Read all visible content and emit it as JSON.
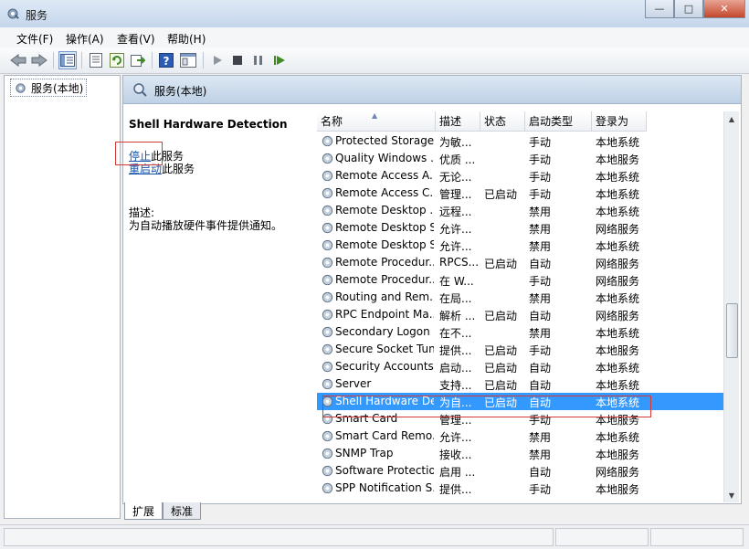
{
  "window": {
    "title": "服务",
    "min_glyph": "—",
    "max_glyph": "□",
    "close_glyph": "✕"
  },
  "menu": [
    {
      "label": "文件(F)"
    },
    {
      "label": "操作(A)"
    },
    {
      "label": "查看(V)"
    },
    {
      "label": "帮助(H)"
    }
  ],
  "toolbar": {
    "icons": [
      "back-arrow-icon",
      "forward-arrow-icon",
      "show-tree-icon",
      "properties-icon",
      "refresh-icon",
      "export-icon",
      "help-icon",
      "console-view-icon",
      "start-icon",
      "stop-icon",
      "pause-icon",
      "restart-icon"
    ]
  },
  "tree": {
    "root_label": "服务(本地)"
  },
  "banner": {
    "label": "服务(本地)"
  },
  "detail": {
    "service_name": "Shell Hardware Detection",
    "stop_link": "停止",
    "stop_suffix": "此服务",
    "restart_link": "重启动",
    "restart_suffix": "此服务",
    "desc_label": "描述:",
    "desc_text": "为自动播放硬件事件提供通知。"
  },
  "columns": [
    {
      "label": "名称"
    },
    {
      "label": "描述"
    },
    {
      "label": "状态"
    },
    {
      "label": "启动类型"
    },
    {
      "label": "登录为"
    }
  ],
  "rows": [
    {
      "name": "Protected Storage",
      "desc": "为敏...",
      "status": "",
      "startup": "手动",
      "logon": "本地系统",
      "selected": false
    },
    {
      "name": "Quality Windows ...",
      "desc": "优质 ...",
      "status": "",
      "startup": "手动",
      "logon": "本地服务",
      "selected": false
    },
    {
      "name": "Remote Access A...",
      "desc": "无论...",
      "status": "",
      "startup": "手动",
      "logon": "本地系统",
      "selected": false
    },
    {
      "name": "Remote Access C...",
      "desc": "管理...",
      "status": "已启动",
      "startup": "手动",
      "logon": "本地系统",
      "selected": false
    },
    {
      "name": "Remote Desktop ...",
      "desc": "远程...",
      "status": "",
      "startup": "禁用",
      "logon": "本地系统",
      "selected": false
    },
    {
      "name": "Remote Desktop S...",
      "desc": "允许...",
      "status": "",
      "startup": "禁用",
      "logon": "网络服务",
      "selected": false
    },
    {
      "name": "Remote Desktop S...",
      "desc": "允许...",
      "status": "",
      "startup": "禁用",
      "logon": "本地系统",
      "selected": false
    },
    {
      "name": "Remote Procedur...",
      "desc": "RPCS...",
      "status": "已启动",
      "startup": "自动",
      "logon": "网络服务",
      "selected": false
    },
    {
      "name": "Remote Procedur...",
      "desc": "在 W...",
      "status": "",
      "startup": "手动",
      "logon": "网络服务",
      "selected": false
    },
    {
      "name": "Routing and Rem...",
      "desc": "在局...",
      "status": "",
      "startup": "禁用",
      "logon": "本地系统",
      "selected": false
    },
    {
      "name": "RPC Endpoint Ma...",
      "desc": "解析 ...",
      "status": "已启动",
      "startup": "自动",
      "logon": "网络服务",
      "selected": false
    },
    {
      "name": "Secondary Logon",
      "desc": "在不...",
      "status": "",
      "startup": "禁用",
      "logon": "本地系统",
      "selected": false
    },
    {
      "name": "Secure Socket Tun...",
      "desc": "提供...",
      "status": "已启动",
      "startup": "手动",
      "logon": "本地服务",
      "selected": false
    },
    {
      "name": "Security Accounts...",
      "desc": "启动...",
      "status": "已启动",
      "startup": "自动",
      "logon": "本地系统",
      "selected": false
    },
    {
      "name": "Server",
      "desc": "支持...",
      "status": "已启动",
      "startup": "自动",
      "logon": "本地系统",
      "selected": false
    },
    {
      "name": "Shell Hardware De...",
      "desc": "为自...",
      "status": "已启动",
      "startup": "自动",
      "logon": "本地系统",
      "selected": true
    },
    {
      "name": "Smart Card",
      "desc": "管理...",
      "status": "",
      "startup": "手动",
      "logon": "本地服务",
      "selected": false
    },
    {
      "name": "Smart Card Remo...",
      "desc": "允许...",
      "status": "",
      "startup": "禁用",
      "logon": "本地系统",
      "selected": false
    },
    {
      "name": "SNMP Trap",
      "desc": "接收...",
      "status": "",
      "startup": "禁用",
      "logon": "本地服务",
      "selected": false
    },
    {
      "name": "Software Protection",
      "desc": "启用 ...",
      "status": "",
      "startup": "自动",
      "logon": "网络服务",
      "selected": false
    },
    {
      "name": "SPP Notification S...",
      "desc": "提供...",
      "status": "",
      "startup": "手动",
      "logon": "本地服务",
      "selected": false
    }
  ],
  "tabs": [
    {
      "label": "扩展",
      "active": true
    },
    {
      "label": "标准",
      "active": false
    }
  ],
  "colors": {
    "selection": "#3399ff",
    "link": "#1654a9",
    "highlight_box": "#d23a3a"
  }
}
